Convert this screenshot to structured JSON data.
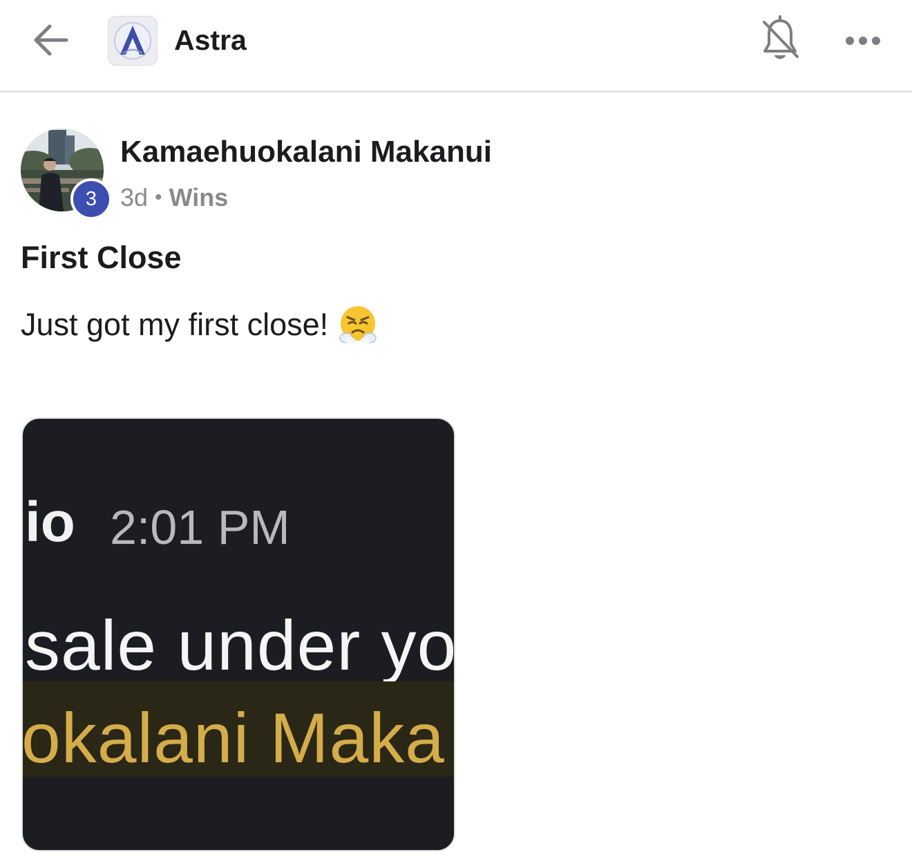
{
  "header": {
    "back_icon": "arrow-left-icon",
    "app_name": "Astra",
    "notification_icon": "bell-off-icon",
    "more_icon": "more-horizontal-icon"
  },
  "post": {
    "author": "Kamaehuokalani Makanui",
    "level": "3",
    "age": "3d",
    "separator": "•",
    "category": "Wins",
    "title": "First Close",
    "body": "Just got my first close!",
    "emoji": "face-with-steam-from-nose",
    "attachment": {
      "name_fragment": "io",
      "time": "2:01 PM",
      "line2": "sale under yo",
      "line3": "okalani Maka"
    }
  },
  "colors": {
    "badge": "#3d4db0",
    "attachment_bg": "#1c1d22",
    "highlight_text": "#d4ac4a"
  }
}
